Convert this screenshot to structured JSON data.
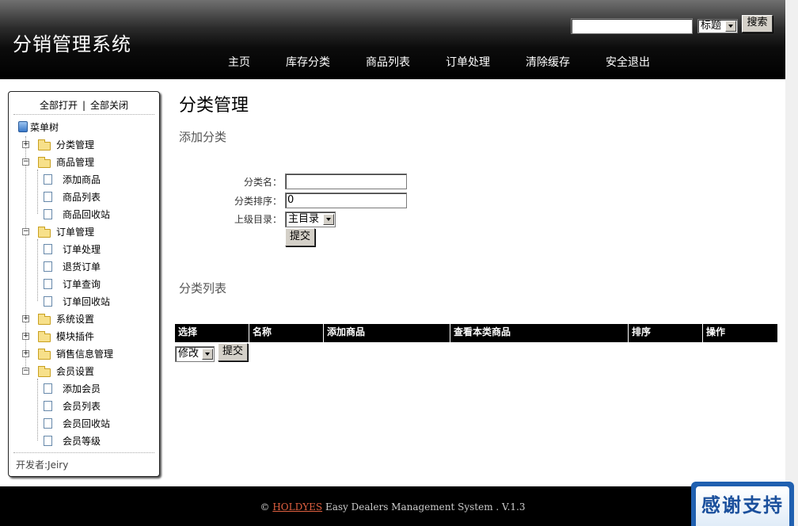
{
  "header": {
    "title": "分销管理系统",
    "search_placeholder": "",
    "search_field_selected": "标题",
    "search_button": "搜索",
    "nav": [
      "主页",
      "库存分类",
      "商品列表",
      "订单处理",
      "清除缓存",
      "安全退出"
    ]
  },
  "sidebar": {
    "expand_all": "全部打开",
    "separator": "|",
    "collapse_all": "全部关闭",
    "root": "菜单树",
    "groups": [
      {
        "label": "分类管理",
        "expanded": false,
        "items": []
      },
      {
        "label": "商品管理",
        "expanded": true,
        "items": [
          "添加商品",
          "商品列表",
          "商品回收站"
        ]
      },
      {
        "label": "订单管理",
        "expanded": true,
        "items": [
          "订单处理",
          "退货订单",
          "订单查询",
          "订单回收站"
        ]
      },
      {
        "label": "系统设置",
        "expanded": false,
        "items": []
      },
      {
        "label": "模块插件",
        "expanded": false,
        "items": []
      },
      {
        "label": "销售信息管理",
        "expanded": false,
        "items": []
      },
      {
        "label": "会员设置",
        "expanded": true,
        "items": [
          "添加会员",
          "会员列表",
          "会员回收站",
          "会员等级"
        ]
      }
    ],
    "footer": "开发者:Jeiry"
  },
  "main": {
    "title": "分类管理",
    "add_section": "添加分类",
    "form": {
      "name_label": "分类名：",
      "name_value": "",
      "order_label": "分类排序：",
      "order_value": "0",
      "parent_label": "上级目录：",
      "parent_value": "主目录",
      "submit": "提交"
    },
    "list_section": "分类列表",
    "columns": [
      "选择",
      "名称",
      "添加商品",
      "查看本类商品",
      "排序",
      "操作"
    ],
    "action_select": "修改",
    "action_submit": "提交"
  },
  "footer": {
    "copyright": "©",
    "brand_link": "HOLDYES",
    "text": "Easy Dealers Management System . V.1.3"
  },
  "badge": {
    "text": "感谢支持"
  }
}
